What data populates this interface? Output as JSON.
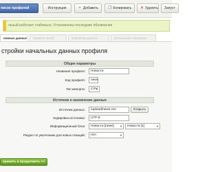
{
  "toolbar": {
    "buttons": [
      {
        "label": "писок профилей"
      },
      {
        "label": "Инструкция"
      },
      {
        "label": "Добавить"
      },
      {
        "label": "Копировать"
      },
      {
        "label": "Удалить"
      },
      {
        "label": "Запуст"
      }
    ]
  },
  "notice": {
    "text": "льный работает стабильно. Установлены последние обновления"
  },
  "tabs": [
    {
      "label": "новные данные"
    },
    {
      "label": "Правило полей"
    },
    {
      "label": "Обработка данных"
    },
    {
      "label": "Исполнение и выгрузка"
    }
  ],
  "page_title": "стройки начальных данных профиля",
  "sections": {
    "general": "Общие параметры",
    "source": "Источник и назначение данных"
  },
  "form": {
    "profile_name_label": "Название профиля:",
    "profile_name_value": "Новости",
    "profile_code_label": "Код профиля:",
    "profile_code_value": "news",
    "import_type_label": "Тип импорта:",
    "import_type_value": "CSV",
    "source_label": "Источник данных:",
    "source_value": "/upload/news.csv",
    "open_button": "Открыть",
    "encoding_label": "Кодировка источника:",
    "encoding_value": "UTF-8",
    "infoblock_label": "Информационный блок:",
    "infoblock_value": "Новости [news]",
    "infoblock_value2": "Новости [1]",
    "default_section_label": "Раздел по умолчанию для новых позиций:",
    "default_section_value": "Нет"
  },
  "submit_label": "хранить и продолжить >>"
}
